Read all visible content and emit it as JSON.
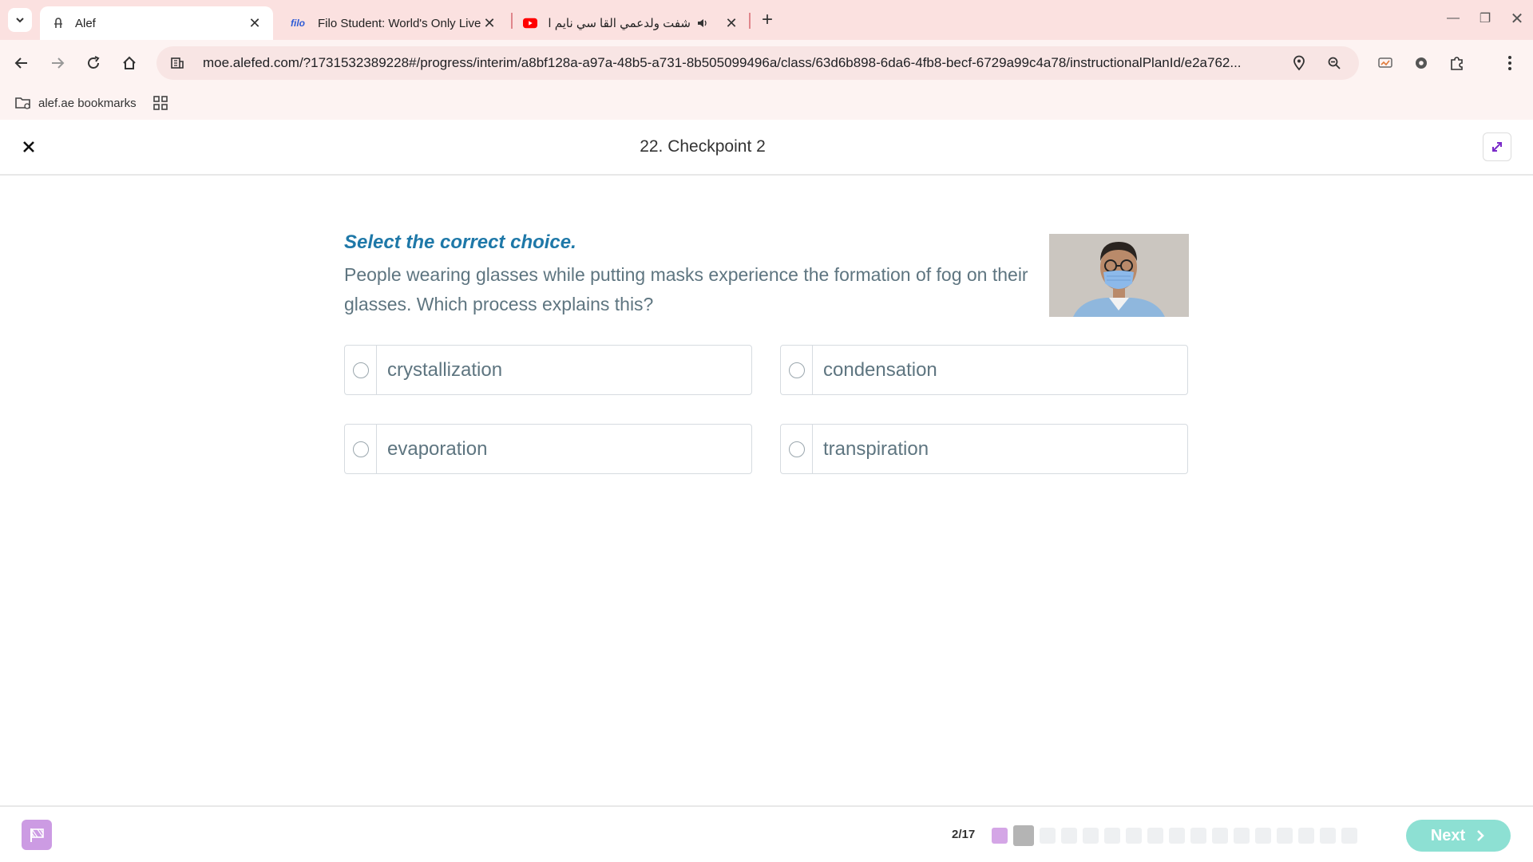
{
  "browser": {
    "tabs": [
      {
        "title": "Alef",
        "icon": "alef-icon",
        "active": true
      },
      {
        "title": "Filo Student: World's Only Live I",
        "icon": "filo-icon",
        "active": false
      },
      {
        "title": "شفت ولدعمي القا سي نايم الا",
        "icon": "youtube-icon",
        "active": false
      }
    ],
    "url": "moe.alefed.com/?1731532389228#/progress/interim/a8bf128a-a97a-48b5-a731-8b505099496a/class/63d6b898-6da6-4fb8-becf-6729a99c4a78/instructionalPlanId/e2a762...",
    "bookmarks": {
      "folder_label": "alef.ae bookmarks"
    }
  },
  "app": {
    "title": "22. Checkpoint 2",
    "question": {
      "instruction": "Select the correct choice.",
      "text": "People wearing glasses while putting masks experience the formation of fog on their glasses. Which process explains this?"
    },
    "options": [
      {
        "label": "crystallization"
      },
      {
        "label": "condensation"
      },
      {
        "label": "evaporation"
      },
      {
        "label": "transpiration"
      }
    ],
    "footer": {
      "progress": "2/17",
      "current": 2,
      "total": 17,
      "next_label": "Next"
    }
  },
  "colors": {
    "tabstrip": "#fbe1e0",
    "instruction": "#1e78a8",
    "next_button": "#8de0d3",
    "flag_button": "#cc9be3"
  }
}
